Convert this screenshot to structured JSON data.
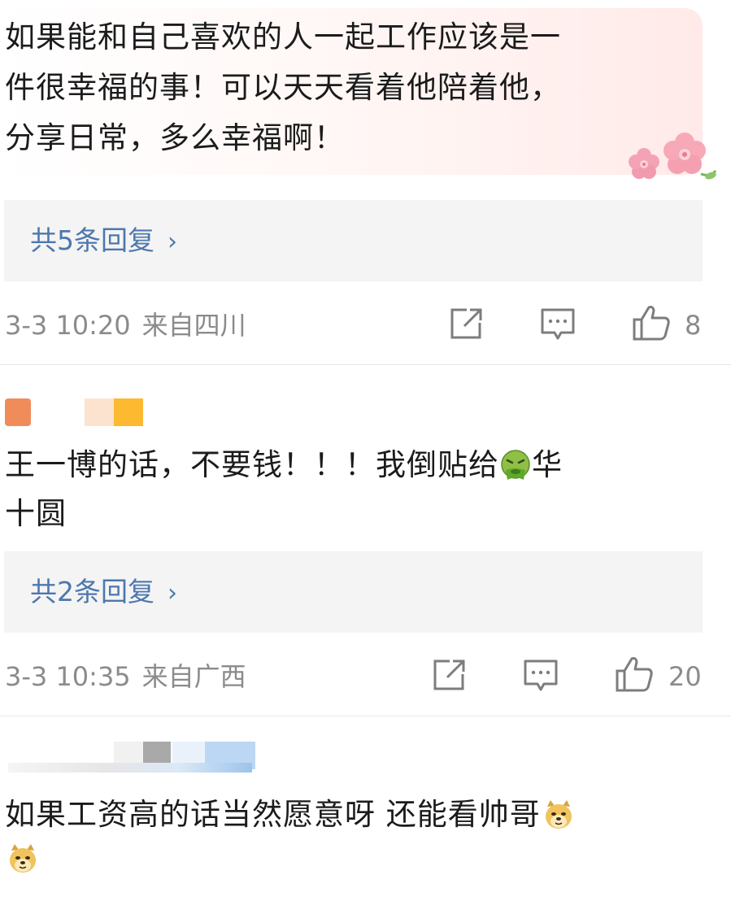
{
  "comments": [
    {
      "text_lines": [
        "如果能和自己喜欢的人一起工作应该是一",
        "件很幸福的事！可以天天看着他陪着他，",
        "分享日常，多么幸福啊！"
      ],
      "reply_label": "共5条回复",
      "chevron": "›",
      "date": "3-3 10:20",
      "location": "来自四川",
      "likes": "8"
    },
    {
      "text_lines": [
        "王一博的话，不要钱！！！我倒贴给",
        "十圆"
      ],
      "text_line1_suffix": "华",
      "inline_emoji": "nauseated-face-emoji",
      "reply_label": "共2条回复",
      "chevron": "›",
      "date": "3-3 10:35",
      "location": "来自广西",
      "likes": "20"
    },
    {
      "text_lines": [
        "如果工资高的话当然愿意呀 还能看帅哥"
      ],
      "inline_emoji": "doge-emoji"
    }
  ],
  "icons": {
    "share": "share-icon",
    "comment": "comment-icon",
    "like": "thumbs-up-icon",
    "decoration": "cherry-blossom-decoration"
  },
  "colors": {
    "reply_link": "#4e77ad",
    "meta": "#8b8b8b",
    "reply_bg": "#f4f4f4",
    "card_tint": "#ffeae9"
  }
}
